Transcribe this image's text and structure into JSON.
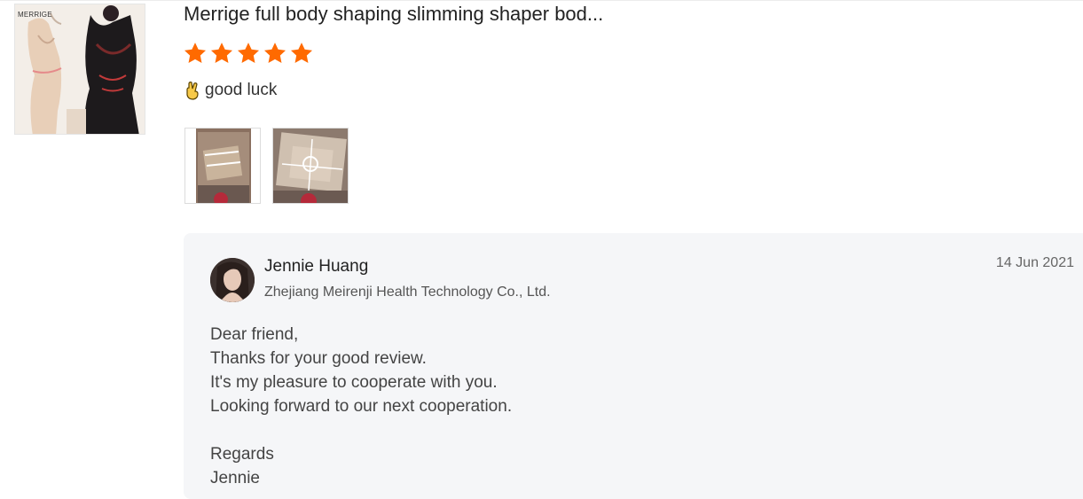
{
  "product": {
    "title": "Merrige full body shaping slimming shaper bod...",
    "image_brand": "MERRIGE",
    "rating": 5,
    "rating_max": 5,
    "star_color": "#ff6a00"
  },
  "review": {
    "text": "good luck",
    "emoji_icon": "crossed-fingers-icon",
    "photos": [
      "review-photo-1",
      "review-photo-2"
    ]
  },
  "reply": {
    "seller_name": "Jennie Huang",
    "company": "Zhejiang Meirenji Health Technology Co., Ltd.",
    "date": "14 Jun 2021",
    "lines": [
      "Dear friend,",
      "Thanks for your good review.",
      "It's my pleasure to cooperate with you.",
      "Looking forward to our next cooperation.",
      "",
      "Regards",
      "Jennie"
    ]
  }
}
